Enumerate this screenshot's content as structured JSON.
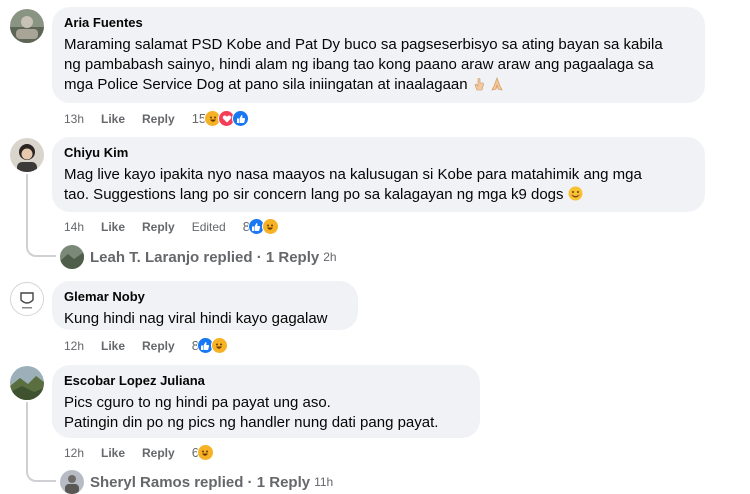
{
  "comments": [
    {
      "author": "Aria Fuentes",
      "lines": [
        "Maraming salamat PSD Kobe and Pat Dy buco sa pagseserbisyo sa ating bayan sa kabila",
        "ng pambabash sainyo, hindi alam ng ibang tao kong paano araw araw ang pagaalaga sa",
        "mga Police Service Dog at pano sila iniingatan at inaalagaan"
      ],
      "time": "13h",
      "like": "Like",
      "reply": "Reply",
      "reactions": {
        "count": "15",
        "icons": [
          "haha-icon",
          "love-icon",
          "like-icon"
        ]
      }
    },
    {
      "author": "Chiyu Kim",
      "lines": [
        "Mag live kayo ipakita nyo nasa maayos na kalusugan si Kobe para matahimik ang mga",
        "tao. Suggestions lang po sir concern lang po sa kalagayan ng mga k9 dogs"
      ],
      "time": "14h",
      "like": "Like",
      "reply": "Reply",
      "edited": "Edited",
      "reactions": {
        "count": "8",
        "icons": [
          "like-icon",
          "haha-icon"
        ]
      },
      "replies": {
        "text": "Leah T. Laranjo replied · 1 Reply",
        "time": "2h"
      }
    },
    {
      "author": "Glemar Noby",
      "lines": [
        "Kung hindi nag viral hindi kayo gagalaw"
      ],
      "time": "12h",
      "like": "Like",
      "reply": "Reply",
      "reactions": {
        "count": "8",
        "icons": [
          "like-icon",
          "haha-icon"
        ]
      }
    },
    {
      "author": "Escobar Lopez Juliana",
      "lines": [
        "Pics cguro to ng hindi pa payat ung aso.",
        "Patingin din po ng pics ng handler nung dati pang payat."
      ],
      "time": "12h",
      "like": "Like",
      "reply": "Reply",
      "reactions": {
        "count": "6",
        "icons": [
          "haha-icon"
        ]
      },
      "replies": {
        "text": "Sheryl Ramos replied · 1 Reply",
        "time": "11h"
      }
    }
  ],
  "colors": {
    "bubble": "#f0f2f5",
    "meta_text": "#65676b",
    "like_blue": "#1877f2",
    "love_red": "#f33e58",
    "haha_yellow": "#f7b125"
  }
}
